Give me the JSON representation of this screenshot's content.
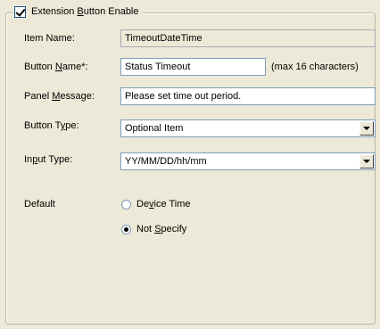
{
  "group": {
    "title_pre": "Extension ",
    "title_u": "B",
    "title_post": "utton Enable",
    "checked": true
  },
  "item_name": {
    "label": "Item Name:",
    "value": "TimeoutDateTime"
  },
  "button_name": {
    "label_pre": "Button ",
    "label_u": "N",
    "label_post": "ame*:",
    "value": "Status Timeout",
    "hint": "(max 16 characters)"
  },
  "panel_message": {
    "label_pre": "Panel ",
    "label_u": "M",
    "label_post": "essage:",
    "value": "Please set time out period."
  },
  "button_type": {
    "label_pre": "Button T",
    "label_u": "y",
    "label_post": "pe:",
    "value": "Optional Item"
  },
  "input_type": {
    "label_pre": "In",
    "label_u": "p",
    "label_post": "ut Type:",
    "value": "YY/MM/DD/hh/mm"
  },
  "default": {
    "label": "Default",
    "options": [
      {
        "pre": "De",
        "u": "v",
        "post": "ice Time",
        "selected": false
      },
      {
        "pre": "Not ",
        "u": "S",
        "post": "pecify",
        "selected": true
      }
    ]
  },
  "icons": {
    "dropdown": "chevron-down-icon"
  }
}
